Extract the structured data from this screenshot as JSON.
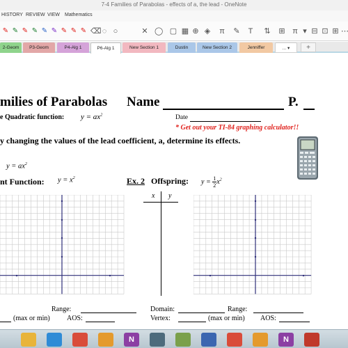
{
  "window": {
    "title": "7-4 Families of Parabolas - effects of a, the lead - OneNote"
  },
  "menu": [
    "HISTORY",
    "REVIEW",
    "VIEW",
    "Mathematics"
  ],
  "ribbon": {
    "pen_colors": [
      "#e0201b",
      "#1b7e2e",
      "#e0201b",
      "#1b7e2e",
      "#2b63c8",
      "#7a2bc8",
      "#e0201b",
      "#e0201b",
      "#e0201b"
    ],
    "symbols": [
      "π",
      "π",
      "π"
    ]
  },
  "sections": {
    "tabs": [
      {
        "label": "2-Geom",
        "color": "#8fd48c"
      },
      {
        "label": "P3-Geom",
        "color": "#e2a7a7"
      },
      {
        "label": "P4-Alg 1",
        "color": "#d5a3d9"
      },
      {
        "label": "P6-Alg 1",
        "color": "#ffffff",
        "active": true
      },
      {
        "label": "New Section 1",
        "color": "#f2b8c0"
      },
      {
        "label": "Dustin",
        "color": "#aac7e8"
      },
      {
        "label": "New Section 2",
        "color": "#aac7e8"
      },
      {
        "label": "Jenniffer",
        "color": "#f2c9a3"
      },
      {
        "label": "...",
        "color": "#ffffff"
      }
    ],
    "add_label": "+"
  },
  "page": {
    "heading": "milies of Parabolas",
    "name_label": "Name",
    "period_label": "P.",
    "quadratic_label": "e Quadratic function:",
    "quadratic_formula": "y = ax",
    "quadratic_exp": "2",
    "date_label": "Date",
    "reminder": "* Get out your TI-84 graphing calculator!!",
    "instruction": "y changing the values of the lead coefficient, a,  determine its effects.",
    "general_formula": "y = ax",
    "general_exp": "2",
    "parent_label": "nt Function:",
    "parent_formula": "y = x",
    "parent_exp": "2",
    "ex2_label": "Ex. 2",
    "offspring_label": "Offspring:",
    "offspring_y": "y =",
    "offspring_num": "1",
    "offspring_den": "2",
    "offspring_x": "x",
    "offspring_exp": "2",
    "table_headers": [
      "x",
      "y"
    ],
    "left_range_label": "Range:",
    "left_minmax": "(max or min)",
    "left_aos": "AOS:",
    "right_domain": "Domain:",
    "right_range": "Range:",
    "right_vertex": "Vertex:",
    "right_minmax": "(max or min)",
    "right_aos": "AOS:"
  },
  "taskbar": {
    "apps": [
      {
        "name": "explorer-icon",
        "color": "#e8b43a"
      },
      {
        "name": "media-player-icon",
        "color": "#2f8bd6"
      },
      {
        "name": "chrome-icon",
        "color": "#d94c3a"
      },
      {
        "name": "paint-icon",
        "color": "#e49a2d"
      },
      {
        "name": "onenote-icon",
        "color": "#8c3fa3",
        "text": "N"
      },
      {
        "name": "calculator-icon",
        "color": "#4d6b7c"
      },
      {
        "name": "app-icon",
        "color": "#7aa04b"
      },
      {
        "name": "smartboard-icon",
        "color": "#3b66b0"
      },
      {
        "name": "chrome-icon-2",
        "color": "#d94c3a"
      },
      {
        "name": "paint-icon-2",
        "color": "#e49a2d"
      },
      {
        "name": "onenote-icon-2",
        "color": "#8c3fa3",
        "text": "N"
      },
      {
        "name": "snipping-icon",
        "color": "#c0392b"
      }
    ]
  }
}
